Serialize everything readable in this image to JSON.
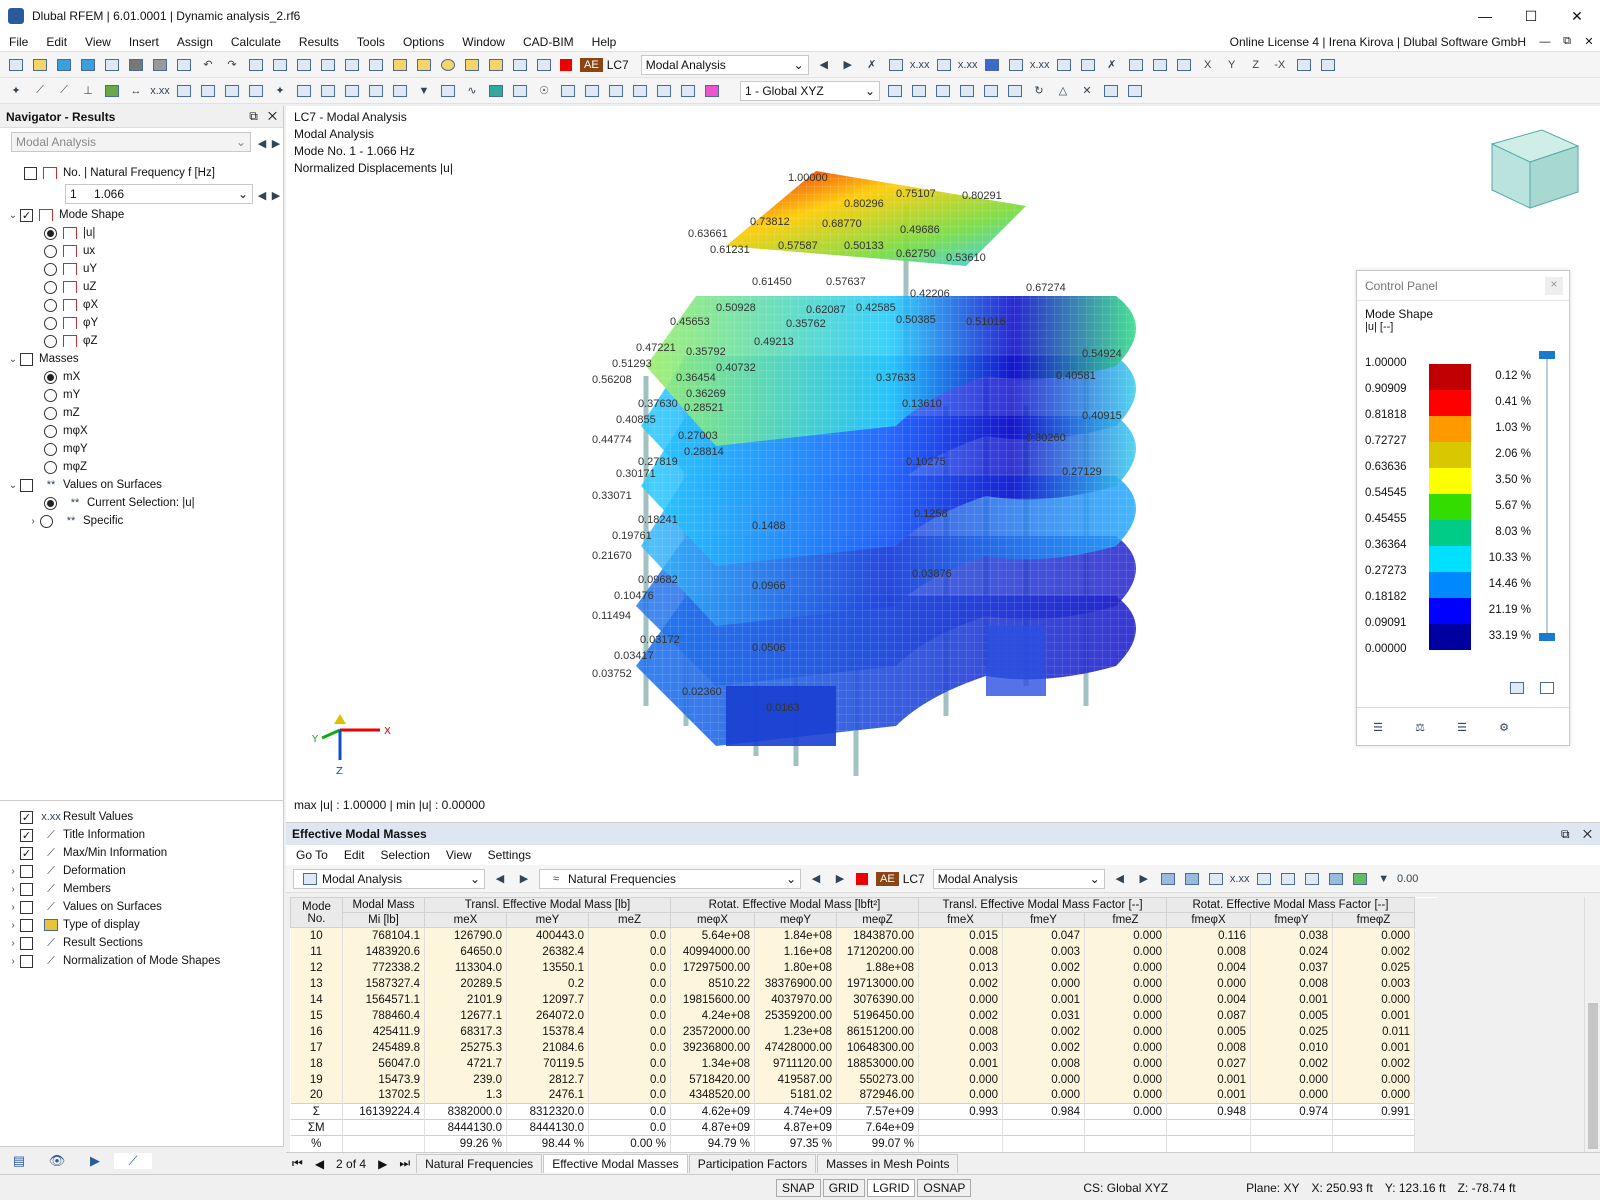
{
  "title": "Dlubal RFEM | 6.01.0001 | Dynamic analysis_2.rf6",
  "menu": [
    "File",
    "Edit",
    "View",
    "Insert",
    "Assign",
    "Calculate",
    "Results",
    "Tools",
    "Options",
    "Window",
    "CAD-BIM",
    "Help"
  ],
  "license": "Online License 4 | Irena Kirova | Dlubal Software GmbH",
  "toolbar": {
    "ae": "AE",
    "lc": "LC7",
    "lc_name": "Modal Analysis",
    "cs": "1 - Global XYZ"
  },
  "navigator": {
    "title": "Navigator - Results",
    "type": "Modal Analysis",
    "freq_header": "No. | Natural Frequency f [Hz]",
    "mode_no": "1",
    "mode_freq": "1.066",
    "mode_shape": "Mode Shape",
    "shape_opts": [
      "|u|",
      "ux",
      "uY",
      "uZ",
      "φX",
      "φY",
      "φZ"
    ],
    "masses": "Masses",
    "mass_opts": [
      "mX",
      "mY",
      "mZ",
      "mφX",
      "mφY",
      "mφZ"
    ],
    "values_on_surfaces": "Values on Surfaces",
    "current_selection": "Current Selection: |u|",
    "specific": "Specific",
    "bottom_items": [
      "Result Values",
      "Title Information",
      "Max/Min Information",
      "Deformation",
      "Members",
      "Values on Surfaces",
      "Type of display",
      "Result Sections",
      "Normalization of Mode Shapes"
    ]
  },
  "view": {
    "lines": [
      "LC7 - Modal Analysis",
      "Modal Analysis",
      "Mode No. 1 - 1.066 Hz",
      "Normalized Displacements |u|"
    ],
    "maxmin": "max |u| : 1.00000 | min |u| : 0.00000",
    "labels": [
      "1.00000",
      "0.80291",
      "0.80296",
      "0.75107",
      "0.73812",
      "0.68770",
      "0.63661",
      "0.61231",
      "0.57587",
      "0.50133",
      "0.49686",
      "0.62750",
      "0.53610",
      "0.67274",
      "0.61450",
      "0.57637",
      "0.50928",
      "0.42585",
      "0.42206",
      "0.45653",
      "0.35762",
      "0.62087",
      "0.49213",
      "0.50385",
      "0.51016",
      "0.47221",
      "0.35792",
      "0.51293",
      "0.40732",
      "0.37633",
      "0.54924",
      "0.56208",
      "0.36454",
      "0.36269",
      "0.40581",
      "0.37630",
      "0.28521",
      "0.13610",
      "0.40915",
      "0.40855",
      "0.44774",
      "0.27003",
      "0.30260",
      "0.28814",
      "0.30171",
      "0.27819",
      "0.10275",
      "0.27129",
      "0.33071",
      "0.18241",
      "0.1488",
      "0.1258",
      "0.19761",
      "0.21670",
      "0.03876",
      "0.09682",
      "0.10476",
      "0.0966",
      "0.11494",
      "0.03172",
      "0.03417",
      "0.0506",
      "0.03752",
      "0.02360",
      "0.0163"
    ]
  },
  "control_panel": {
    "title": "Control Panel",
    "heading": "Mode Shape",
    "unit": "|u| [--]",
    "values": [
      "1.00000",
      "0.90909",
      "0.81818",
      "0.72727",
      "0.63636",
      "0.54545",
      "0.45455",
      "0.36364",
      "0.27273",
      "0.18182",
      "0.09091",
      "0.00000"
    ],
    "colors": [
      "#c00000",
      "#ff0000",
      "#ff9900",
      "#d9c800",
      "#ffff00",
      "#33dd00",
      "#00cc88",
      "#00e0ff",
      "#0088ff",
      "#0000ff",
      "#0000a0"
    ],
    "percents": [
      "0.12 %",
      "0.41 %",
      "1.03 %",
      "2.06 %",
      "3.50 %",
      "5.67 %",
      "8.03 %",
      "10.33 %",
      "14.46 %",
      "21.19 %",
      "33.19 %"
    ]
  },
  "panel": {
    "title": "Effective Modal Masses",
    "menu": [
      "Go To",
      "Edit",
      "Selection",
      "View",
      "Settings"
    ],
    "sel1": "Modal Analysis",
    "sel2": "Natural Frequencies",
    "lc": "LC7",
    "lcname": "Modal Analysis",
    "ae": "AE",
    "headers_top": [
      "Mode\nNo.",
      "Modal Mass",
      "Transl. Effective Modal Mass [lb]",
      "Rotat. Effective Modal Mass [lbft²]",
      "Transl. Effective Modal Mass Factor [--]",
      "Rotat. Effective Modal Mass Factor [--]"
    ],
    "headers_sub": [
      "Mi [lb]",
      "meX",
      "meY",
      "meZ",
      "meφX",
      "meφY",
      "meφZ",
      "fmeX",
      "fmeY",
      "fmeZ",
      "fmeφX",
      "fmeφY",
      "fmeφZ"
    ],
    "rows": [
      [
        "10",
        "768104.1",
        "126790.0",
        "400443.0",
        "0.0",
        "5.64e+08",
        "1.84e+08",
        "1843870.00",
        "0.015",
        "0.047",
        "0.000",
        "0.116",
        "0.038",
        "0.000"
      ],
      [
        "11",
        "1483920.6",
        "64650.0",
        "26382.4",
        "0.0",
        "40994000.00",
        "1.16e+08",
        "17120200.00",
        "0.008",
        "0.003",
        "0.000",
        "0.008",
        "0.024",
        "0.002"
      ],
      [
        "12",
        "772338.2",
        "113304.0",
        "13550.1",
        "0.0",
        "17297500.00",
        "1.80e+08",
        "1.88e+08",
        "0.013",
        "0.002",
        "0.000",
        "0.004",
        "0.037",
        "0.025"
      ],
      [
        "13",
        "1587327.4",
        "20289.5",
        "0.2",
        "0.0",
        "8510.22",
        "38376900.00",
        "19713000.00",
        "0.002",
        "0.000",
        "0.000",
        "0.000",
        "0.008",
        "0.003"
      ],
      [
        "14",
        "1564571.1",
        "2101.9",
        "12097.7",
        "0.0",
        "19815600.00",
        "4037970.00",
        "3076390.00",
        "0.000",
        "0.001",
        "0.000",
        "0.004",
        "0.001",
        "0.000"
      ],
      [
        "15",
        "788460.4",
        "12677.1",
        "264072.0",
        "0.0",
        "4.24e+08",
        "25359200.00",
        "5196450.00",
        "0.002",
        "0.031",
        "0.000",
        "0.087",
        "0.005",
        "0.001"
      ],
      [
        "16",
        "425411.9",
        "68317.3",
        "15378.4",
        "0.0",
        "23572000.00",
        "1.23e+08",
        "86151200.00",
        "0.008",
        "0.002",
        "0.000",
        "0.005",
        "0.025",
        "0.011"
      ],
      [
        "17",
        "245489.8",
        "25275.3",
        "21084.6",
        "0.0",
        "39236800.00",
        "47428000.00",
        "10648300.00",
        "0.003",
        "0.002",
        "0.000",
        "0.008",
        "0.010",
        "0.001"
      ],
      [
        "18",
        "56047.0",
        "4721.7",
        "70119.5",
        "0.0",
        "1.34e+08",
        "9711120.00",
        "18853000.00",
        "0.001",
        "0.008",
        "0.000",
        "0.027",
        "0.002",
        "0.002"
      ],
      [
        "19",
        "15473.9",
        "239.0",
        "2812.7",
        "0.0",
        "5718420.00",
        "419587.00",
        "550273.00",
        "0.000",
        "0.000",
        "0.000",
        "0.001",
        "0.000",
        "0.000"
      ],
      [
        "20",
        "13702.5",
        "1.3",
        "2476.1",
        "0.0",
        "4348520.00",
        "5181.02",
        "872946.00",
        "0.000",
        "0.000",
        "0.000",
        "0.001",
        "0.000",
        "0.000"
      ]
    ],
    "sum": [
      "Σ",
      "16139224.4",
      "8382000.0",
      "8312320.0",
      "0.0",
      "4.62e+09",
      "4.74e+09",
      "7.57e+09",
      "0.993",
      "0.984",
      "0.000",
      "0.948",
      "0.974",
      "0.991"
    ],
    "summ": [
      "ΣM",
      "",
      "8444130.0",
      "8444130.0",
      "0.0",
      "4.87e+09",
      "4.87e+09",
      "7.64e+09",
      "",
      "",
      "",
      "",
      "",
      ""
    ],
    "pct": [
      "%",
      "",
      "99.26 %",
      "98.44 %",
      "0.00 %",
      "94.79 %",
      "97.35 %",
      "99.07 %",
      "",
      "",
      "",
      "",
      "",
      ""
    ],
    "page": "2 of 4",
    "tabs": [
      "Natural Frequencies",
      "Effective Modal Masses",
      "Participation Factors",
      "Masses in Mesh Points"
    ]
  },
  "status": {
    "toggles": [
      "SNAP",
      "GRID",
      "LGRID",
      "OSNAP"
    ],
    "cs": "CS: Global XYZ",
    "plane": "Plane: XY",
    "x": "X: 250.93 ft",
    "y": "Y: 123.16 ft",
    "z": "Z: -78.74 ft"
  }
}
